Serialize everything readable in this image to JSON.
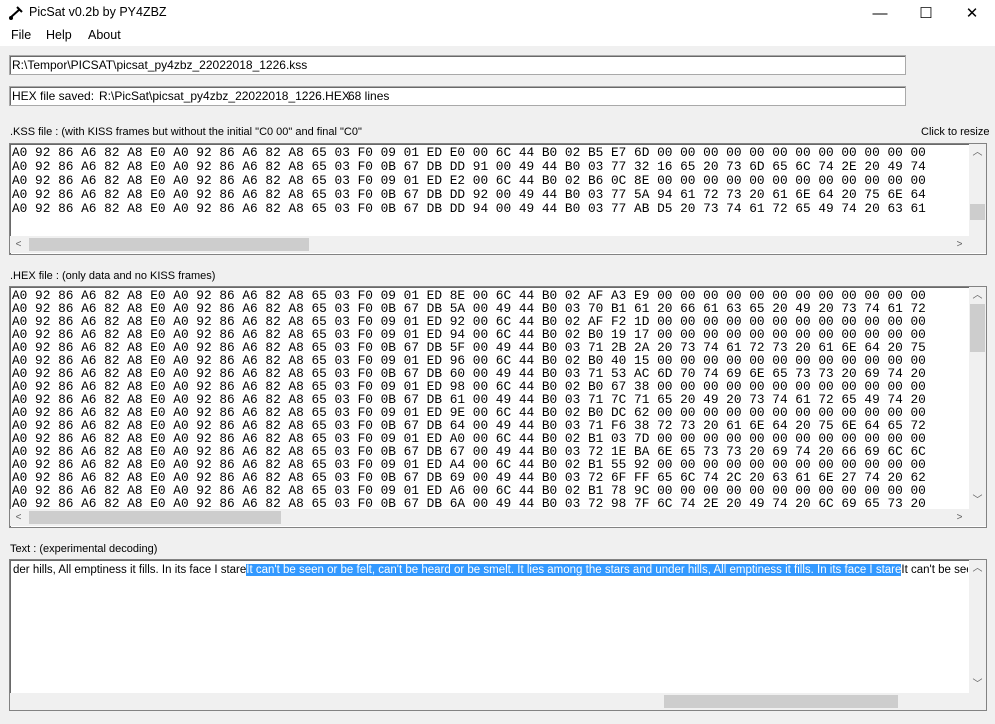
{
  "window": {
    "title": "PicSat  v0.2b   by PY4ZBZ",
    "minimize": "—",
    "maximize": "☐",
    "close": "✕"
  },
  "menu": [
    {
      "label": "File"
    },
    {
      "label": "Help"
    },
    {
      "label": "About"
    }
  ],
  "kss_path": "R:\\Tempor\\PICSAT\\picsat_py4zbz_22022018_1226.kss",
  "hex_saved": {
    "label": "HEX file saved:",
    "path": "R:\\PicSat\\picsat_py4zbz_22022018_1226.HEX",
    "lines": "68 lines"
  },
  "kss": {
    "label": ".KSS file : (with KISS frames but without the initial \"C0 00\" and final \"C0\"",
    "resize_hint": "Click to resize",
    "rows": [
      "A0 92 86 A6 82 A8 E0 A0 92 86 A6 82 A8 65 03 F0 09 01 ED E0 00 6C 44 B0 02 B5 E7 6D 00 00 00 00 00 00 00 00 00 00 00 00",
      "A0 92 86 A6 82 A8 E0 A0 92 86 A6 82 A8 65 03 F0 0B 67 DB DD 91 00 49 44 B0 03 77 32 16 65 20 73 6D 65 6C 74 2E 20 49 74",
      "A0 92 86 A6 82 A8 E0 A0 92 86 A6 82 A8 65 03 F0 09 01 ED E2 00 6C 44 B0 02 B6 0C 8E 00 00 00 00 00 00 00 00 00 00 00 00",
      "A0 92 86 A6 82 A8 E0 A0 92 86 A6 82 A8 65 03 F0 0B 67 DB DD 92 00 49 44 B0 03 77 5A 94 61 72 73 20 61 6E 64 20 75 6E 64",
      "A0 92 86 A6 82 A8 E0 A0 92 86 A6 82 A8 65 03 F0 0B 67 DB DD 94 00 49 44 B0 03 77 AB D5 20 73 74 61 72 65 49 74 20 63 61"
    ]
  },
  "hex": {
    "label": ".HEX file : (only data and no KISS frames)",
    "rows": [
      "A0 92 86 A6 82 A8 E0 A0 92 86 A6 82 A8 65 03 F0 09 01 ED 8E 00 6C 44 B0 02 AF A3 E9 00 00 00 00 00 00 00 00 00 00 00 00",
      "A0 92 86 A6 82 A8 E0 A0 92 86 A6 82 A8 65 03 F0 0B 67 DB 5A 00 49 44 B0 03 70 B1 61 20 66 61 63 65 20 49 20 73 74 61 72",
      "A0 92 86 A6 82 A8 E0 A0 92 86 A6 82 A8 65 03 F0 09 01 ED 92 00 6C 44 B0 02 AF F2 1D 00 00 00 00 00 00 00 00 00 00 00 00",
      "A0 92 86 A6 82 A8 E0 A0 92 86 A6 82 A8 65 03 F0 09 01 ED 94 00 6C 44 B0 02 B0 19 17 00 00 00 00 00 00 00 00 00 00 00 00",
      "A0 92 86 A6 82 A8 E0 A0 92 86 A6 82 A8 65 03 F0 0B 67 DB 5F 00 49 44 B0 03 71 2B 2A 20 73 74 61 72 73 20 61 6E 64 20 75",
      "A0 92 86 A6 82 A8 E0 A0 92 86 A6 82 A8 65 03 F0 09 01 ED 96 00 6C 44 B0 02 B0 40 15 00 00 00 00 00 00 00 00 00 00 00 00",
      "A0 92 86 A6 82 A8 E0 A0 92 86 A6 82 A8 65 03 F0 0B 67 DB 60 00 49 44 B0 03 71 53 AC 6D 70 74 69 6E 65 73 73 20 69 74 20",
      "A0 92 86 A6 82 A8 E0 A0 92 86 A6 82 A8 65 03 F0 09 01 ED 98 00 6C 44 B0 02 B0 67 38 00 00 00 00 00 00 00 00 00 00 00 00",
      "A0 92 86 A6 82 A8 E0 A0 92 86 A6 82 A8 65 03 F0 0B 67 DB 61 00 49 44 B0 03 71 7C 71 65 20 49 20 73 74 61 72 65 49 74 20",
      "A0 92 86 A6 82 A8 E0 A0 92 86 A6 82 A8 65 03 F0 09 01 ED 9E 00 6C 44 B0 02 B0 DC 62 00 00 00 00 00 00 00 00 00 00 00 00",
      "A0 92 86 A6 82 A8 E0 A0 92 86 A6 82 A8 65 03 F0 0B 67 DB 64 00 49 44 B0 03 71 F6 38 72 73 20 61 6E 64 20 75 6E 64 65 72",
      "A0 92 86 A6 82 A8 E0 A0 92 86 A6 82 A8 65 03 F0 09 01 ED A0 00 6C 44 B0 02 B1 03 7D 00 00 00 00 00 00 00 00 00 00 00 00",
      "A0 92 86 A6 82 A8 E0 A0 92 86 A6 82 A8 65 03 F0 0B 67 DB 67 00 49 44 B0 03 72 1E BA 6E 65 73 73 20 69 74 20 66 69 6C 6C",
      "A0 92 86 A6 82 A8 E0 A0 92 86 A6 82 A8 65 03 F0 09 01 ED A4 00 6C 44 B0 02 B1 55 92 00 00 00 00 00 00 00 00 00 00 00 00",
      "A0 92 86 A6 82 A8 E0 A0 92 86 A6 82 A8 65 03 F0 0B 67 DB 69 00 49 44 B0 03 72 6F FF 65 6C 74 2C 20 63 61 6E 27 74 20 62",
      "A0 92 86 A6 82 A8 E0 A0 92 86 A6 82 A8 65 03 F0 09 01 ED A6 00 6C 44 B0 02 B1 78 9C 00 00 00 00 00 00 00 00 00 00 00 00",
      "A0 92 86 A6 82 A8 E0 A0 92 86 A6 82 A8 65 03 F0 0B 67 DB 6A 00 49 44 B0 03 72 98 7F 6C 74 2E 20 49 74 20 6C 69 65 73 20"
    ]
  },
  "text": {
    "label": "Text : (experimental decoding)",
    "before": "der hills, All emptiness it fills. In its face I stare",
    "selected": "It can't be seen or be felt, can't be heard or be smelt. It lies among the stars and under hills, All emptiness it fills. In its face I stare",
    "after": "It can't be seen ore smelt. It l"
  }
}
